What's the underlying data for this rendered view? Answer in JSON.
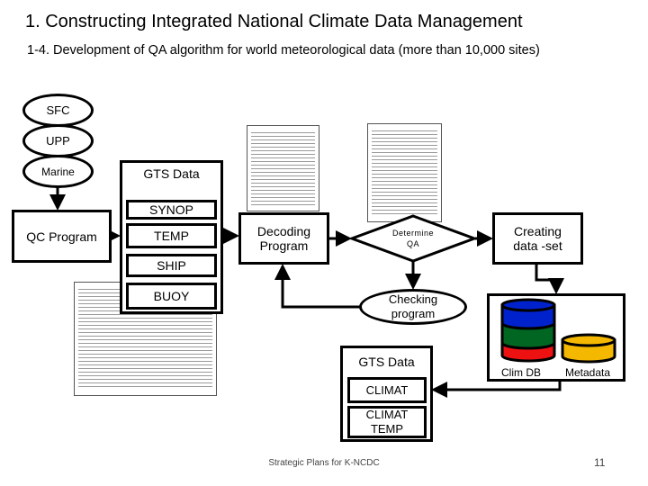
{
  "slide": {
    "title": "1. Constructing Integrated National Climate Data Management",
    "subtitle": "1-4. Development of QA algorithm for world meteorological data (more than 10,000 sites)",
    "footer": "Strategic Plans for K-NCDC",
    "page_number": "11"
  },
  "diagram": {
    "sources": [
      "SFC",
      "UPP",
      "Marine"
    ],
    "qc_program": "QC Program",
    "gts_group_1": {
      "label": "GTS Data",
      "items": [
        "SYNOP",
        "TEMP",
        "SHIP",
        "BUOY"
      ]
    },
    "decoding_program": "Decoding Program",
    "determine_qa": "Determine QA",
    "checking_program": "Checking program",
    "creating_dataset": "Creating data -set",
    "storage": {
      "clim_db": "Clim DB",
      "metadata": "Metadata"
    },
    "gts_group_2": {
      "label": "GTS Data",
      "items": [
        "CLIMAT",
        "CLIMAT TEMP"
      ]
    },
    "colors": {
      "db_top": "#0022cc",
      "db_middle": "#006622",
      "db_bottom": "#ee1111",
      "metadata": "#f5b800"
    }
  }
}
